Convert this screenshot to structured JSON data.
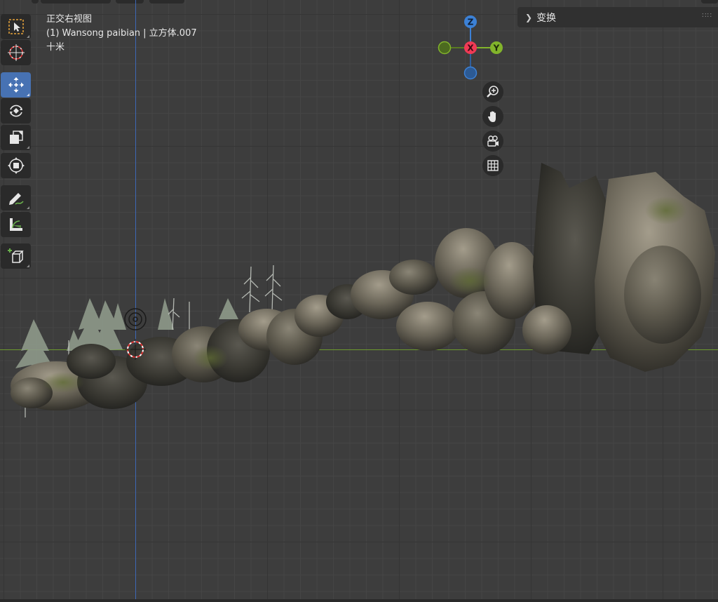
{
  "viewport": {
    "view_name": "正交右视图",
    "object_info": "(1) Wansong paibian | 立方体.007",
    "grid_scale": "十米"
  },
  "gizmo": {
    "z_label": "Z",
    "x_label": "X",
    "y_label": "Y",
    "colors": {
      "x": "#f03a55",
      "y": "#82b42b",
      "z": "#3c81d6"
    }
  },
  "npanel": {
    "transform_label": "变换"
  },
  "toolbar": {
    "tools": [
      "select-box",
      "cursor",
      "move",
      "rotate",
      "scale",
      "transform",
      "annotate",
      "measure",
      "add-cube"
    ],
    "active_tool": "move"
  },
  "nav_buttons": [
    "zoom",
    "pan",
    "camera",
    "ortho-grid"
  ]
}
